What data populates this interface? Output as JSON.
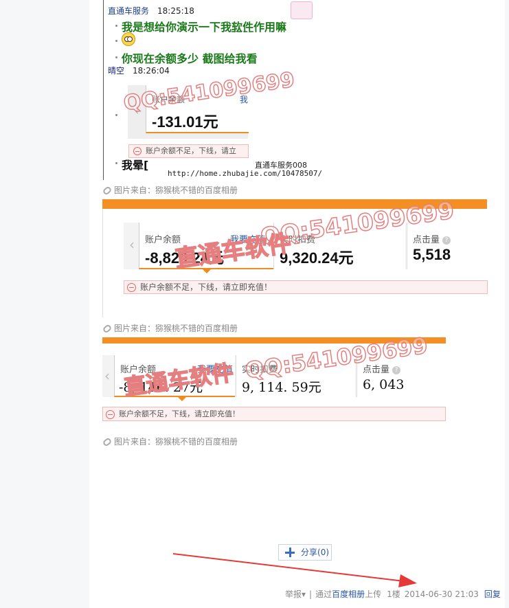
{
  "chat": {
    "sender1": "直通车服务",
    "time1": "18:25:18",
    "msg1_a": "我是想给你演示一下我",
    "msg1_b": "软件",
    "msg1_c": "作用嘛",
    "msg3": "你现在余额多少  截图给我看",
    "sender2": "晴空",
    "time2": "18:26:04",
    "mini_label": "账户余额",
    "mini_link": "我",
    "mini_value": "-131.01元",
    "mini_warn": "账户余额不足，下线，请立",
    "msg4": "我晕[",
    "signature_name": "直通车服务008",
    "signature_url": "http://home.zhubajie.com/10478507/"
  },
  "caption_text": "图片来自：猕猴桃不错的百度相册",
  "watermark_qq": "QQ:541099699",
  "watermark_brand": "直通车软件",
  "panel1": {
    "balance_label": "账户余额",
    "recharge_link": "我要充值",
    "balance_value": "-8,820.24元",
    "spend_label": "实时扣费",
    "spend_value": "9,320.24元",
    "clicks_label": "点击量",
    "clicks_value": "5,518",
    "warning": "账户余额不足，下线，请立即充值！"
  },
  "panel2": {
    "balance_label": "账户余额",
    "recharge_link": "我要充值",
    "balance_value": "-8, 146. 27元",
    "spend_label": "实时扣费",
    "spend_value": "9, 114. 59元",
    "clicks_label": "点击量",
    "clicks_value": "6, 043",
    "warning": "账户余额不足，下线，请立即充值！"
  },
  "share": {
    "label": "分享",
    "count": "(0)"
  },
  "footer": {
    "report": "举报",
    "via_prefix": "通过",
    "via_link": "百度相册",
    "via_suffix": "上传",
    "floor": "1楼",
    "datetime": "2014-06-30 21:03",
    "reply": "回复"
  },
  "colors": {
    "accent_orange": "#f48f23",
    "chat_green": "#1b7a1b",
    "link_blue": "#2a55a5",
    "arrow_red": "#e53935"
  }
}
